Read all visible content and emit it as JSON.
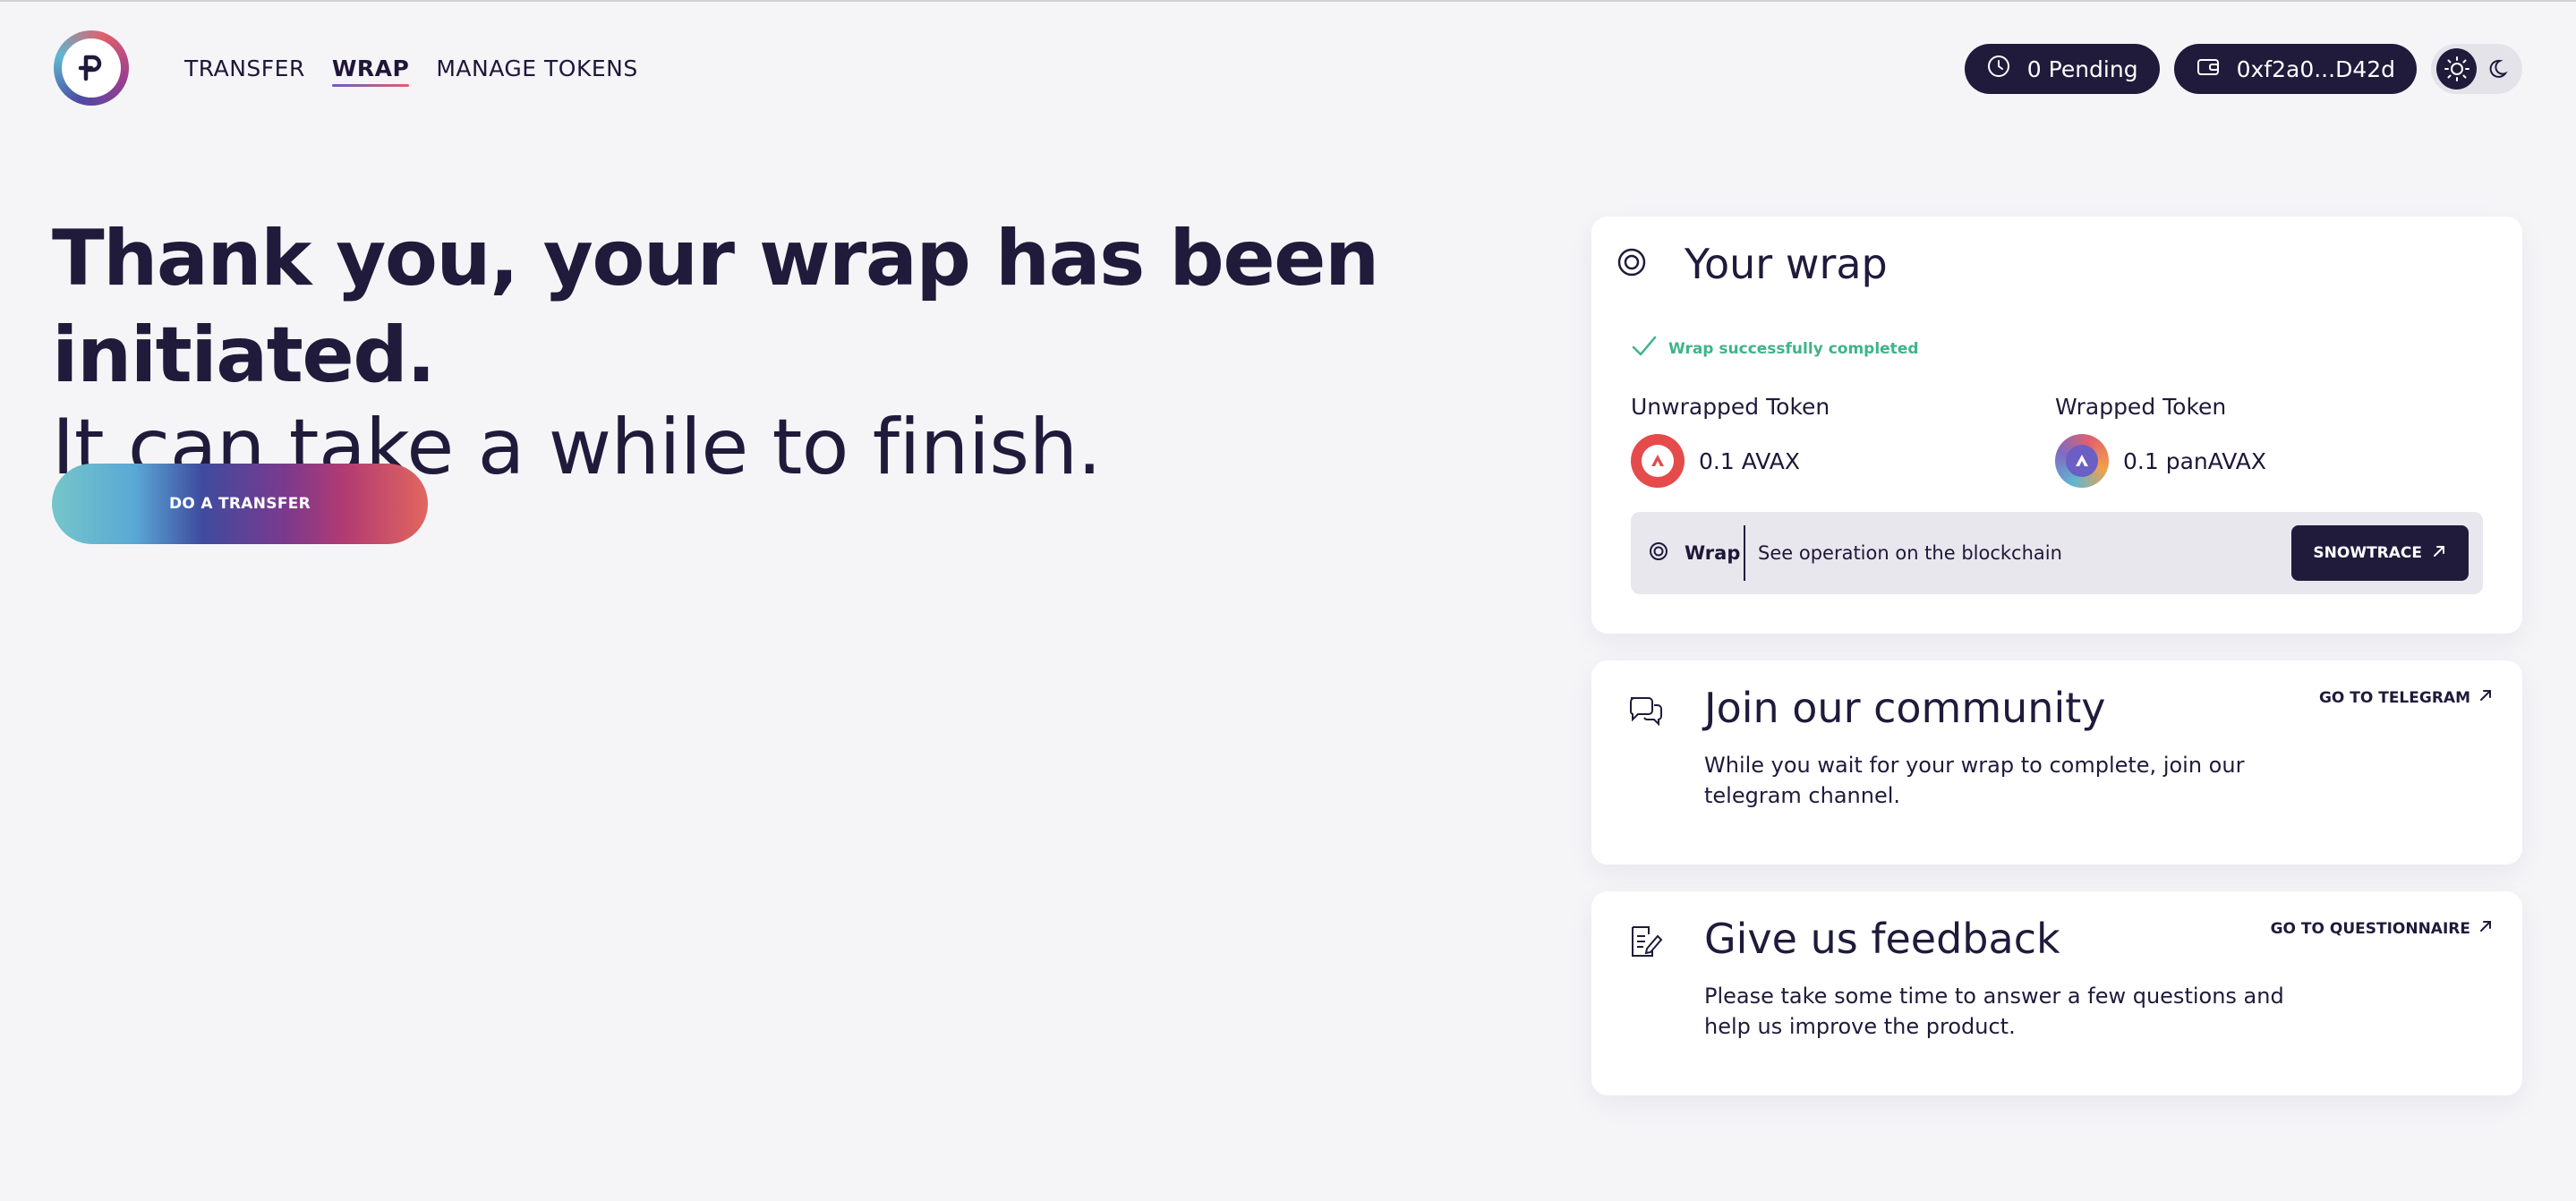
{
  "colors": {
    "background": "#f5f5f8",
    "ink": "#201a3b",
    "success": "#3eb489",
    "avax_red": "#e54b4b"
  },
  "header": {
    "nav": [
      "TRANSFER",
      "WRAP",
      "MANAGE TOKENS"
    ],
    "active_nav": "WRAP",
    "pending_label": "0 Pending",
    "wallet_label": "0xf2a0...D42d",
    "icons": [
      "logo-p",
      "clock-icon",
      "wallet-icon",
      "sun-icon",
      "moon-icon"
    ]
  },
  "hero": {
    "title": "Thank you, your wrap has been initiated.",
    "subtitle": "It can take a while to finish.",
    "cta": "DO A TRANSFER"
  },
  "wrap_card": {
    "title": "Your wrap",
    "status": "Wrap successfully completed",
    "unwrapped_label": "Unwrapped Token",
    "unwrapped_value": "0.1 AVAX",
    "wrapped_label": "Wrapped Token",
    "wrapped_value": "0.1 panAVAX",
    "op_label": "Wrap",
    "op_text": "See operation on the blockchain",
    "op_button": "SNOWTRACE"
  },
  "community_card": {
    "title": "Join our community",
    "desc": "While you wait for your wrap to complete, join our telegram channel.",
    "link": "GO TO TELEGRAM"
  },
  "feedback_card": {
    "title": "Give us feedback",
    "desc": "Please take some time to answer a few questions and help us improve the product.",
    "link": "GO TO QUESTIONNAIRE"
  }
}
